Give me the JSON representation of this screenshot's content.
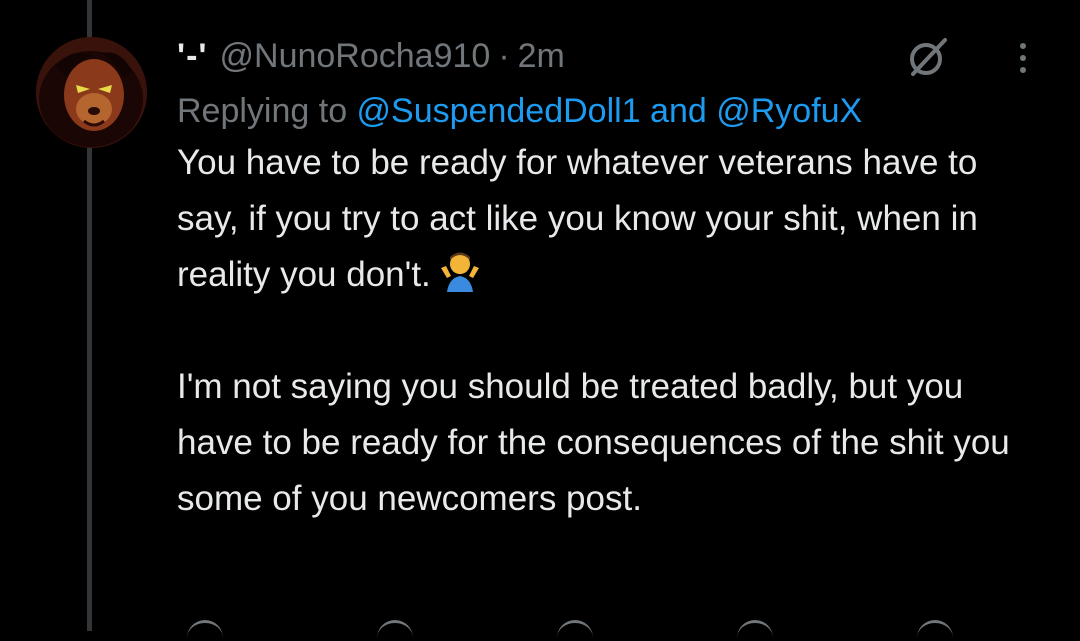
{
  "tweet": {
    "display_name": "'-'",
    "handle": "@NunoRocha910",
    "separator": "·",
    "time": "2m",
    "replying_prefix": "Replying to ",
    "reply_mention_1": "@SuspendedDoll1",
    "reply_conjunction": " and ",
    "reply_mention_2": "@RyofuX",
    "paragraph_1": "You have to be ready for whatever veterans have to say, if you try to act like you know your shit, when in reality you don't.",
    "paragraph_2": "I'm not saying you should be treated badly, but you have to be ready for the consequences of the shit you some of you newcomers post."
  },
  "icons": {
    "avatar": "avatar-lion-image",
    "grok": "grok-icon",
    "more": "more-options-icon",
    "emoji": "person-shrugging-emoji"
  },
  "colors": {
    "background": "#000000",
    "text": "#e7e9ea",
    "secondary": "#71767b",
    "link": "#1d9bf0",
    "thread_line": "#333639"
  }
}
